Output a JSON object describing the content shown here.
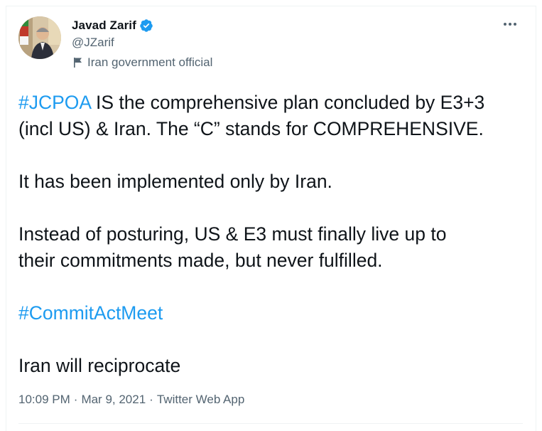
{
  "author": {
    "display_name": "Javad Zarif",
    "handle": "@JZarif",
    "label": "Iran government official"
  },
  "icons": {
    "verified": "verified-badge-icon",
    "label": "flag-icon",
    "more": "more-icon"
  },
  "tweet": {
    "p1_hashtag": "#JCPOA",
    "p1_line1_rest": " IS the comprehensive plan concluded by E3+3",
    "p1_line2": "(incl US) & Iran. The “C” stands for COMPREHENSIVE.",
    "p2": "It has been implemented only by Iran.",
    "p3_line1": "Instead of posturing, US & E3 must finally live up to",
    "p3_line2": "their commitments made, but never fulfilled.",
    "p4_hashtag": "#CommitActMeet",
    "p5": "Iran will reciprocate"
  },
  "meta": {
    "time": "10:09 PM",
    "date": "Mar 9, 2021",
    "source": "Twitter Web App",
    "separator": "·"
  },
  "colors": {
    "accent": "#1d9bf0",
    "text": "#0f1419",
    "secondary": "#536471",
    "border": "#eff3f4"
  }
}
